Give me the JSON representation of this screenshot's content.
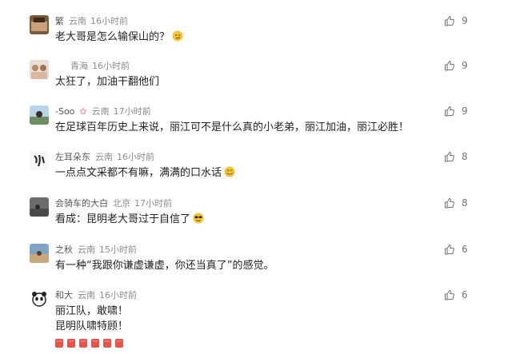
{
  "comments": [
    {
      "user": "繁",
      "location": "云南",
      "time": "16小时前",
      "text": "老大哥是怎么输保山的？",
      "likes": "9",
      "emoji": "smirk-emoji"
    },
    {
      "user": "",
      "location": "青海",
      "time": "16小时前",
      "text": "太狂了，加油干翻他们",
      "likes": "9"
    },
    {
      "user": "-Soo",
      "location": "云南",
      "time": "17小时前",
      "text": "在足球百年历史上来说，丽江可不是什么真的小老弟，丽江加油，丽江必胜！",
      "likes": "9"
    },
    {
      "user": "左耳朵东",
      "location": "云南",
      "time": "16小时前",
      "text": "一点点文采都不有嘛，满满的口水话",
      "likes": "8",
      "emoji": "drool-emoji"
    },
    {
      "user": "会骑车的大白",
      "location": "北京",
      "time": "17小时前",
      "text": "看成：昆明老大哥过于自信了",
      "likes": "8",
      "emoji": "cool-emoji"
    },
    {
      "user": "之秋",
      "location": "云南",
      "time": "15小时前",
      "text": "有一种“我跟你谦虚谦虚，你还当真了”的感觉。",
      "likes": "6"
    },
    {
      "user": "和大",
      "location": "云南",
      "time": "16小时前",
      "text": "丽江队，敢啸！",
      "text2": "昆明队啸特顾！",
      "likes": "6"
    }
  ],
  "colors": {
    "accent_red": "#e8534a",
    "meta": "#8a8a8a"
  }
}
